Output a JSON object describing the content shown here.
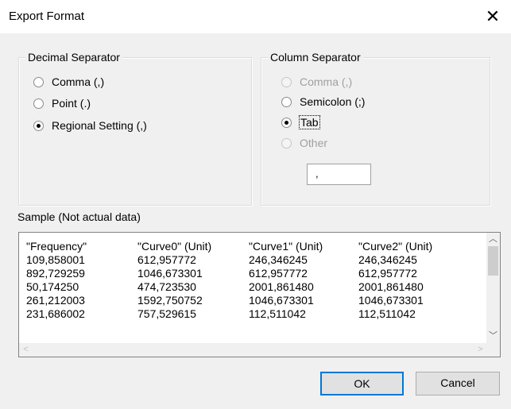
{
  "window": {
    "title": "Export Format",
    "close_glyph": "✕"
  },
  "decimal_separator": {
    "legend": "Decimal Separator",
    "options": [
      {
        "label": "Comma (,)",
        "checked": false,
        "enabled": true
      },
      {
        "label": "Point (.)",
        "checked": false,
        "enabled": true
      },
      {
        "label": "Regional Setting (,)",
        "checked": true,
        "enabled": true
      }
    ]
  },
  "column_separator": {
    "legend": "Column Separator",
    "options": [
      {
        "label": "Comma (,)",
        "checked": false,
        "enabled": false
      },
      {
        "label": "Semicolon (;)",
        "checked": false,
        "enabled": true
      },
      {
        "label": "Tab",
        "checked": true,
        "enabled": true
      },
      {
        "label": "Other",
        "checked": false,
        "enabled": false
      }
    ],
    "other_value": ","
  },
  "sample": {
    "label": "Sample (Not actual data)",
    "rows": [
      [
        "\"Frequency\"",
        "\"Curve0\" (Unit)",
        "\"Curve1\" (Unit)",
        "\"Curve2\" (Unit)"
      ],
      [
        "109,858001",
        "612,957772",
        "246,346245",
        "246,346245"
      ],
      [
        "892,729259",
        "1046,673301",
        "612,957772",
        "612,957772"
      ],
      [
        "50,174250",
        "474,723530",
        "2001,861480",
        "2001,861480"
      ],
      [
        "261,212003",
        "1592,750752",
        "1046,673301",
        "1046,673301"
      ],
      [
        "231,686002",
        "757,529615",
        "112,511042",
        "112,511042"
      ]
    ],
    "scroll_glyphs": {
      "up": "︿",
      "down": "﹀",
      "left": "<",
      "right": ">"
    }
  },
  "buttons": {
    "ok": "OK",
    "cancel": "Cancel"
  }
}
